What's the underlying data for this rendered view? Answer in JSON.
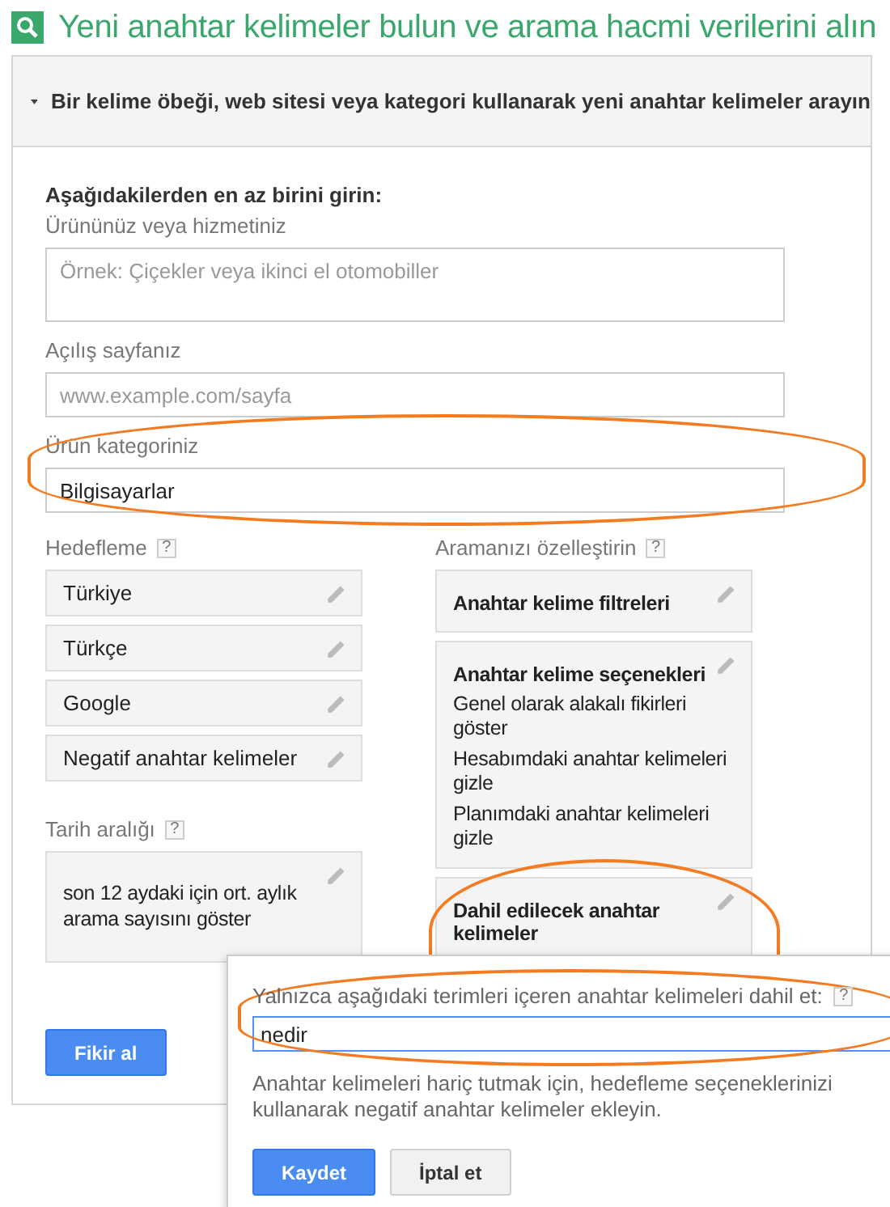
{
  "title": "Yeni anahtar kelimeler bulun ve arama hacmi verilerini alın",
  "section": {
    "heading": "Bir kelime öbeği, web sitesi veya kategori kullanarak yeni anahtar kelimeler arayın",
    "expanded": true,
    "intro": "Aşağıdakilerden en az birini girin:",
    "fields": [
      {
        "kind": "textarea",
        "label": "Ürününüz veya hizmetiniz",
        "placeholder": "Örnek: Çiçekler veya ikinci el otomobiller",
        "highlighted": false
      },
      {
        "kind": "input",
        "label": "Açılış sayfanız",
        "placeholder": "www.example.com/sayfa",
        "highlighted": false
      },
      {
        "kind": "input",
        "label": "Ürün kategoriniz",
        "value": "Bilgisayarlar",
        "highlighted": true
      }
    ],
    "targeting": {
      "label": "Hedefleme",
      "help": "?",
      "items": [
        "Türkiye",
        "Türkçe",
        "Google",
        "Negatif anahtar kelimeler"
      ]
    },
    "date_range": {
      "label": "Tarih aralığı",
      "help": "?",
      "value": "son 12 aydaki için ort. aylık arama sayısını göster"
    },
    "customize": {
      "label": "Aramanızı özelleştirin",
      "help": "?",
      "cards": [
        {
          "title": "Anahtar kelime filtreleri",
          "highlighted": false
        },
        {
          "title": "Anahtar kelime seçenekleri",
          "lines": [
            "Genel olarak alakalı fikirleri göster",
            "Hesabımdaki anahtar kelimeleri gizle",
            "Planımdaki anahtar kelimeleri gizle"
          ],
          "highlighted": false
        },
        {
          "title": "Dahil edilecek anahtar kelimeler",
          "highlighted": true
        }
      ]
    },
    "submit": "Fikir al"
  },
  "popup": {
    "label": "Yalnızca aşağıdaki terimleri içeren anahtar kelimeleri dahil et:",
    "help": "?",
    "value": "nedir",
    "highlighted": true,
    "note": "Anahtar kelimeleri hariç tutmak için, hedefleme seçeneklerinizi kullanarak negatif anahtar kelimeler ekleyin.",
    "buttons": [
      {
        "kind": "primary",
        "label": "Kaydet"
      },
      {
        "kind": "secondary",
        "label": "İptal et"
      }
    ]
  }
}
